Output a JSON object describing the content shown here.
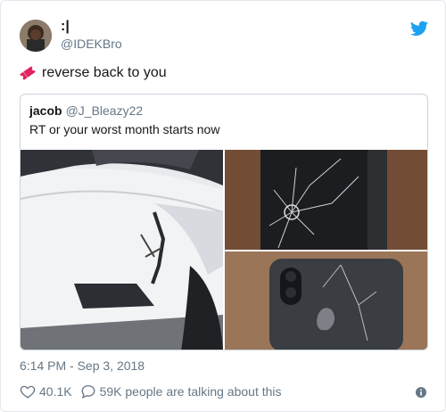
{
  "tweet": {
    "display_name": ":|",
    "handle": "@IDEKBro",
    "text": "reverse back to you",
    "emoji_icon": "ticket-icon",
    "timestamp": "6:14 PM - Sep 3, 2018",
    "likes": "40.1K",
    "talking": "59K people are talking about this"
  },
  "quote": {
    "name": "jacob",
    "handle": "@J_Bleazy22",
    "text": "RT or your worst month starts now"
  },
  "icons": {
    "brand": "twitter-bird-icon",
    "like": "heart-icon",
    "reply": "speech-bubble-icon",
    "info": "info-icon"
  },
  "colors": {
    "twitter_blue": "#1da1f2",
    "secondary_text": "#657786",
    "border": "#e1e8ed",
    "ticket_red": "#e0245e"
  }
}
